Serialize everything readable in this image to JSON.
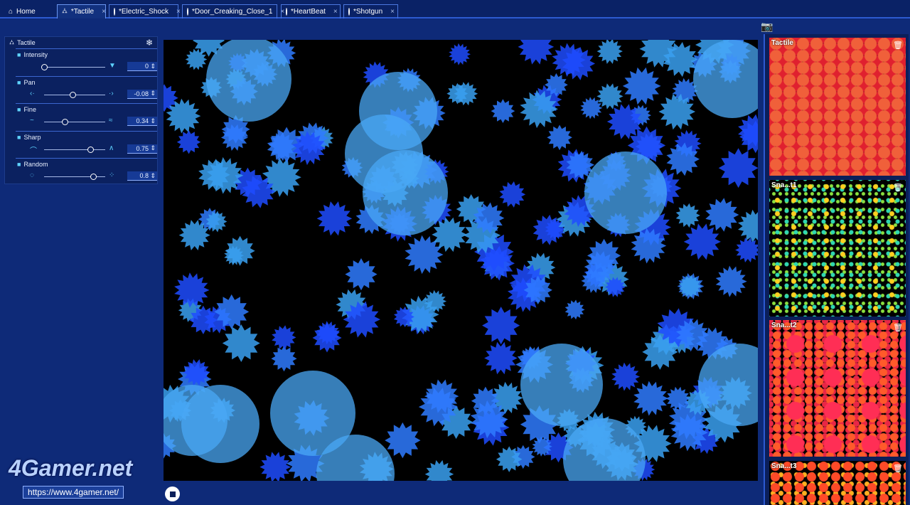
{
  "tabs": [
    {
      "label": "Home",
      "icon": "home-icon"
    },
    {
      "label": "*Tactile",
      "icon": "tactile-icon",
      "active": true
    },
    {
      "label": "*Electric_Shock",
      "icon": "haptic-icon"
    },
    {
      "label": "*Door_Creaking_Close_1",
      "icon": "haptic-icon"
    },
    {
      "label": "*HeartBeat",
      "icon": "haptic-icon"
    },
    {
      "label": "*Shotgun",
      "icon": "haptic-icon"
    }
  ],
  "panel": {
    "title": "Tactile",
    "params": [
      {
        "label": "Intensity",
        "value": "0",
        "fraction": 0.0
      },
      {
        "label": "Pan",
        "value": "-0.08",
        "fraction": 0.46
      },
      {
        "label": "Fine",
        "value": "0.34",
        "fraction": 0.34
      },
      {
        "label": "Sharp",
        "value": "0.75",
        "fraction": 0.75
      },
      {
        "label": "Random",
        "value": "0.8",
        "fraction": 0.8
      }
    ]
  },
  "snapshots": [
    {
      "label": "Tactile"
    },
    {
      "label": "Sna...t1"
    },
    {
      "label": "Sna...t2"
    },
    {
      "label": "Sna...t3"
    }
  ],
  "watermark": {
    "logo": "4Gamer.net",
    "url": "https://www.4gamer.net/"
  },
  "colors": {
    "accent": "#2c5ad0",
    "shape_a": "#2f7bff",
    "shape_b": "#1e4cff",
    "shape_c": "#39a0f0"
  }
}
